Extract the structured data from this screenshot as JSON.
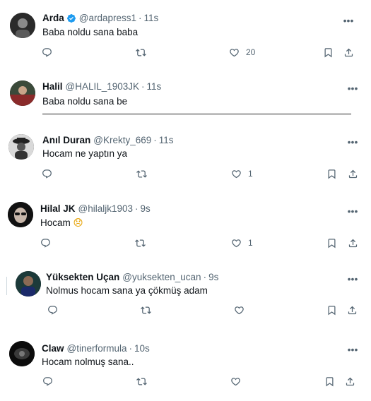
{
  "tweets": [
    {
      "name": "Arda",
      "verified": true,
      "handle": "@ardapress1",
      "time": "11s",
      "text": "Baba noldu sana baba",
      "likes": "20"
    },
    {
      "name": "Halil",
      "handle": "@HALIL_1903JK",
      "time": "11s",
      "text": "Baba noldu sana be"
    },
    {
      "name": "Anıl Duran",
      "handle": "@Krekty_669",
      "time": "11s",
      "text": "Hocam ne yaptın ya",
      "likes": "1"
    },
    {
      "name": "Hilal JK",
      "handle": "@hilaljk1903",
      "time": "9s",
      "text": "Hocam",
      "emoji": "😞",
      "likes": "1"
    },
    {
      "name": "Yüksekten Uçan",
      "handle": "@yuksekten_ucan",
      "time": "9s",
      "text": "Nolmus hocam sana ya çökmüş adam"
    },
    {
      "name": "Claw",
      "handle": "@tinerformula",
      "time": "10s",
      "text": "Hocam nolmuş sana.."
    }
  ],
  "icons": {
    "reply": "reply-icon",
    "retweet": "retweet-icon",
    "like": "like-icon",
    "bookmark": "bookmark-icon",
    "share": "share-icon",
    "more": "more-icon",
    "verified": "verified-badge-icon"
  },
  "colors": {
    "text": "#0f1419",
    "secondary": "#536471",
    "verified": "#1d9bf0"
  }
}
